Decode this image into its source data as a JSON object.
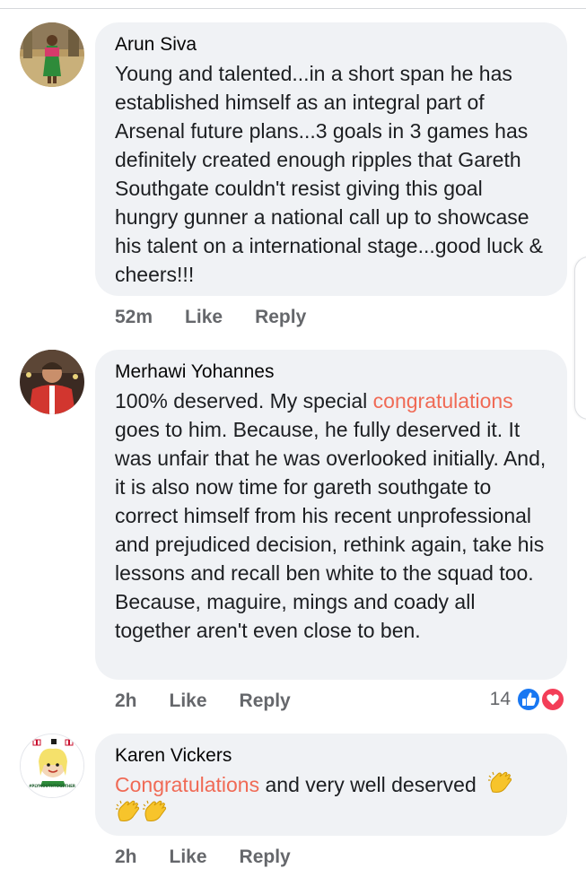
{
  "comments": [
    {
      "author": "Arun Siva",
      "text": "Young and talented...in a short span he has established himself as an integral part of Arsenal future plans...3 goals in 3 games has definitely created enough ripples that Gareth Southgate couldn't resist giving this goal hungry gunner a national call up to showcase his talent on a  international stage...good luck & cheers!!!",
      "time": "52m",
      "like_label": "Like",
      "reply_label": "Reply"
    },
    {
      "author": "Merhawi Yohannes",
      "text_before": "100% deserved. My special ",
      "highlight": "congratulations",
      "text_after": " goes to him. Because, he fully deserved it. It was unfair that he was overlooked initially. And, it is also now time for gareth southgate to correct himself from his recent unprofessional and prejudiced decision, rethink again, take his lessons and recall ben white to the squad too. Because, maguire, mings and coady all together aren't even close to ben.",
      "time": "2h",
      "like_label": "Like",
      "reply_label": "Reply",
      "reaction_count": "14",
      "reaction_icons": [
        "like-reaction-icon",
        "love-reaction-icon"
      ]
    },
    {
      "author": "Karen Vickers",
      "highlight": "Congratulations",
      "text_after": " and very well deserved",
      "emoji": [
        "clapping-hands",
        "clapping-hands",
        "clapping-hands"
      ],
      "time": "2h",
      "like_label": "Like",
      "reply_label": "Reply",
      "avatar_caption": "#PLYMOUTHTOGETHER"
    }
  ],
  "colors": {
    "bubble": "#f0f2f5",
    "highlight": "#f06a55",
    "meta": "#65676b",
    "like_blue": "#1877f2",
    "love_red": "#f33e58"
  }
}
